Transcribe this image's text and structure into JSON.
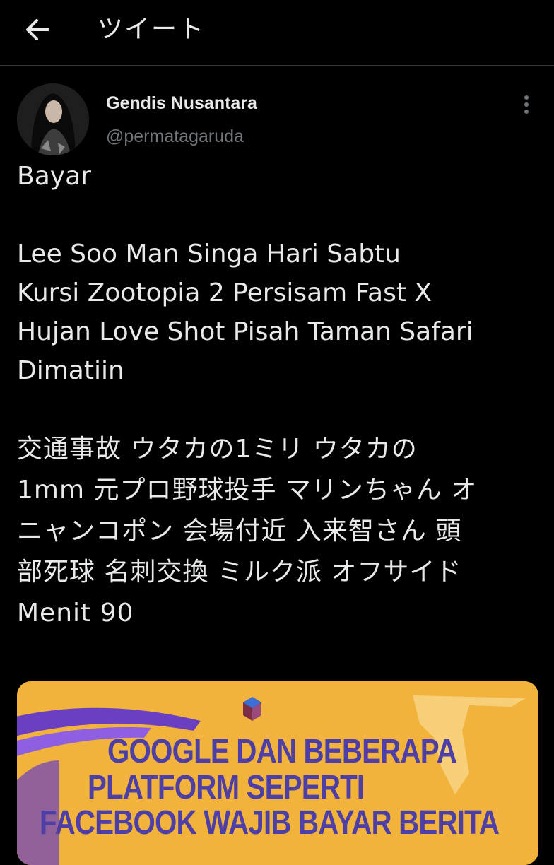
{
  "header": {
    "title": "ツイート",
    "back_icon": "arrow-left-icon"
  },
  "tweet": {
    "author": {
      "display_name": "Gendis Nusantara",
      "handle": "@permatagaruda"
    },
    "more_icon": "vertical-ellipsis-icon",
    "text": {
      "line1": "Bayar",
      "paragraph2": "Lee Soo Man Singa Hari Sabtu\nKursi Zootopia 2 Persisam Fast X\nHujan Love Shot Pisah Taman Safari\nDimatiin",
      "paragraph3": "交通事故 ウタカの1ミリ ウタカの\n1mm 元プロ野球投手 マリンちゃん オ\nニャンコポン 会場付近 入来智さん 頭\n部死球 名刺交換 ミルク派 オフサイド\nMenit 90"
    },
    "media": {
      "headline_line1": "GOOGLE DAN BEBERAPA",
      "headline_line2": "PLATFORM SEPERTI",
      "headline_line3": "FACEBOOK WAJIB BAYAR BERITA",
      "background_color": "#f2b33d",
      "accent_color": "#6a3fc2",
      "text_color": "#4e3fa6"
    }
  },
  "colors": {
    "background": "#000000",
    "text_primary": "#e7e9ea",
    "text_secondary": "#71767b",
    "divider": "#2f3336"
  }
}
